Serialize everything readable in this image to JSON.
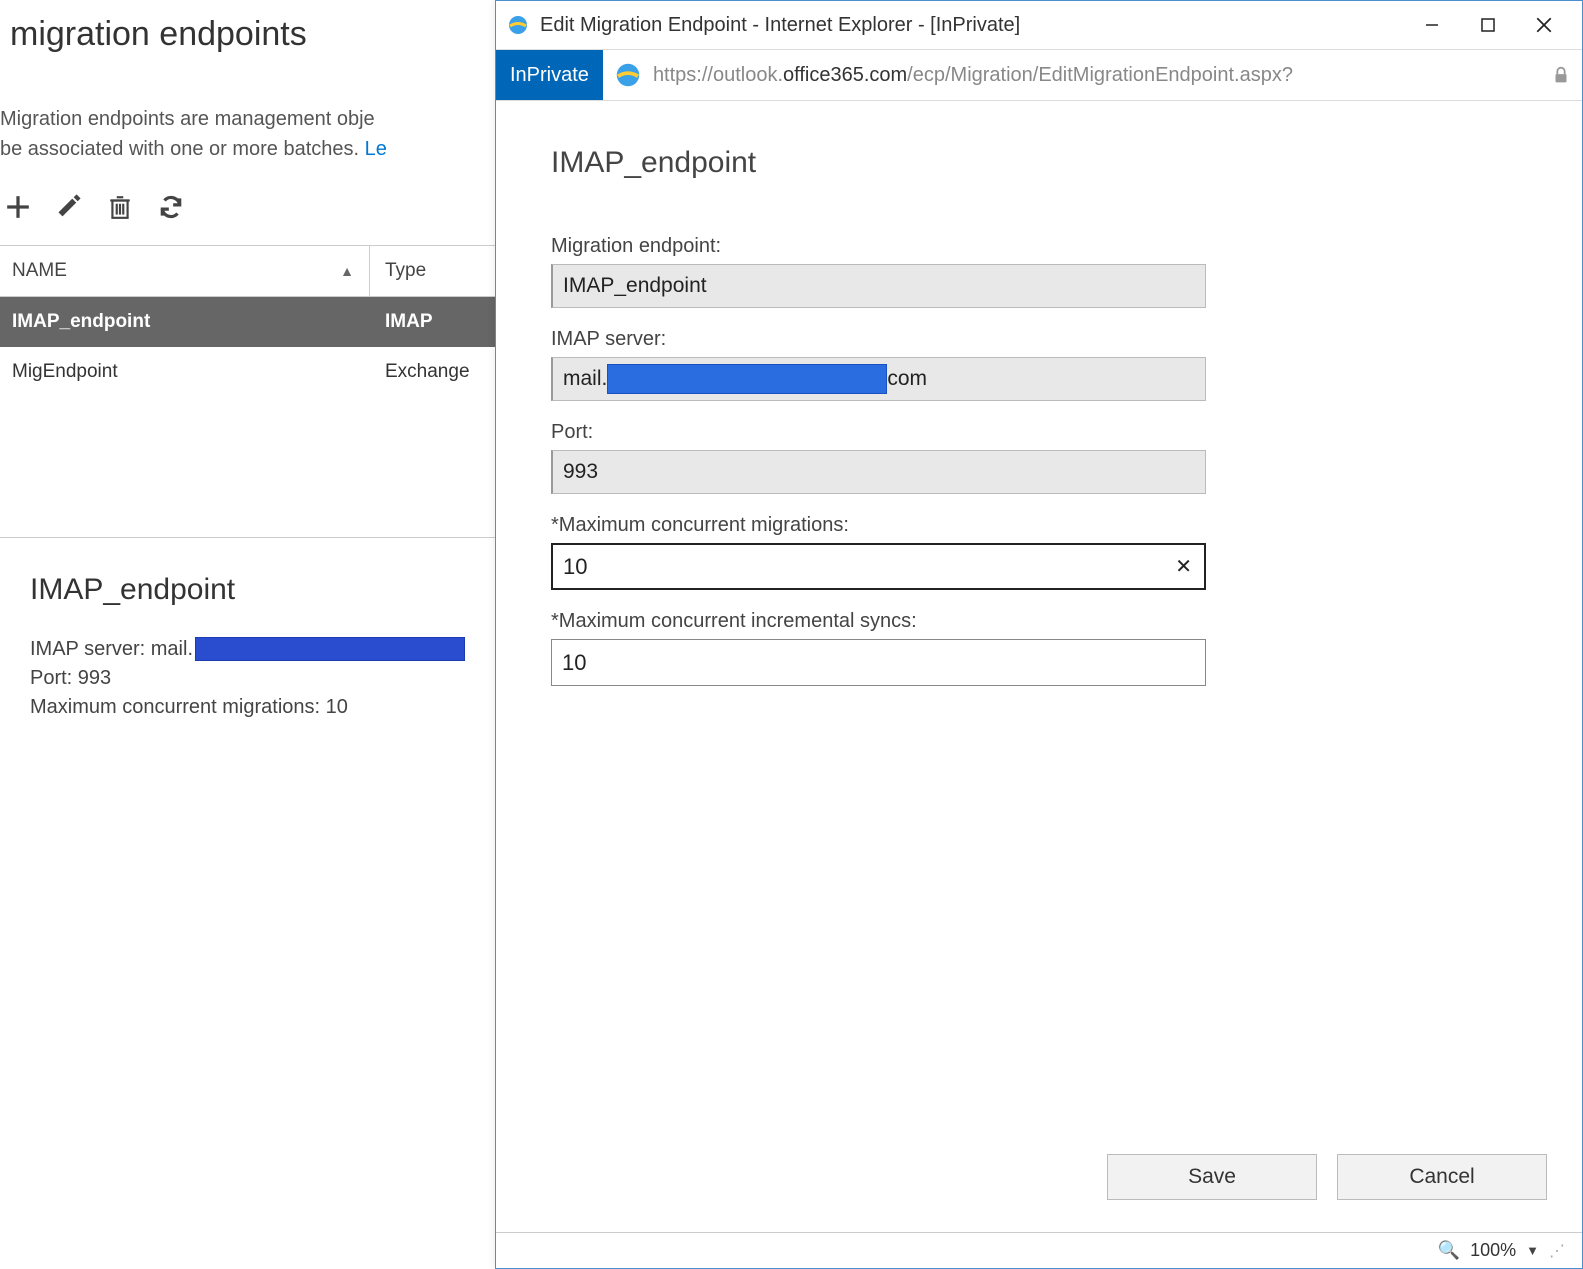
{
  "bg": {
    "title": "migration endpoints",
    "desc_part1": "Migration endpoints are management obje",
    "desc_part2": "be associated with one or more batches. ",
    "desc_link": "Le",
    "cols": {
      "name": "NAME",
      "type": "Type"
    },
    "rows": [
      {
        "name": "IMAP_endpoint",
        "type": "IMAP",
        "selected": true
      },
      {
        "name": "MigEndpoint",
        "type": "Exchange",
        "selected": false
      }
    ],
    "details": {
      "title": "IMAP_endpoint",
      "server_label": "IMAP server: mail.",
      "port_line": "Port: 993",
      "max_line": "Maximum concurrent migrations: 10"
    }
  },
  "popup": {
    "window_title": "Edit Migration Endpoint - Internet Explorer - [InPrivate]",
    "inprivate": "InPrivate",
    "url_gray1": "https://outlook.",
    "url_black": "office365.com",
    "url_gray2": "/ecp/Migration/EditMigrationEndpoint.aspx?",
    "heading": "IMAP_endpoint",
    "labels": {
      "endpoint": "Migration endpoint:",
      "server": "IMAP server:",
      "port": "Port:",
      "max_migrations": "*Maximum concurrent migrations:",
      "max_syncs": "*Maximum concurrent incremental syncs:"
    },
    "values": {
      "endpoint": "IMAP_endpoint",
      "server_pre": "mail.",
      "server_post": "com",
      "port": "993",
      "max_migrations": "10",
      "max_syncs": "10"
    },
    "buttons": {
      "save": "Save",
      "cancel": "Cancel"
    },
    "zoom": "100%"
  }
}
